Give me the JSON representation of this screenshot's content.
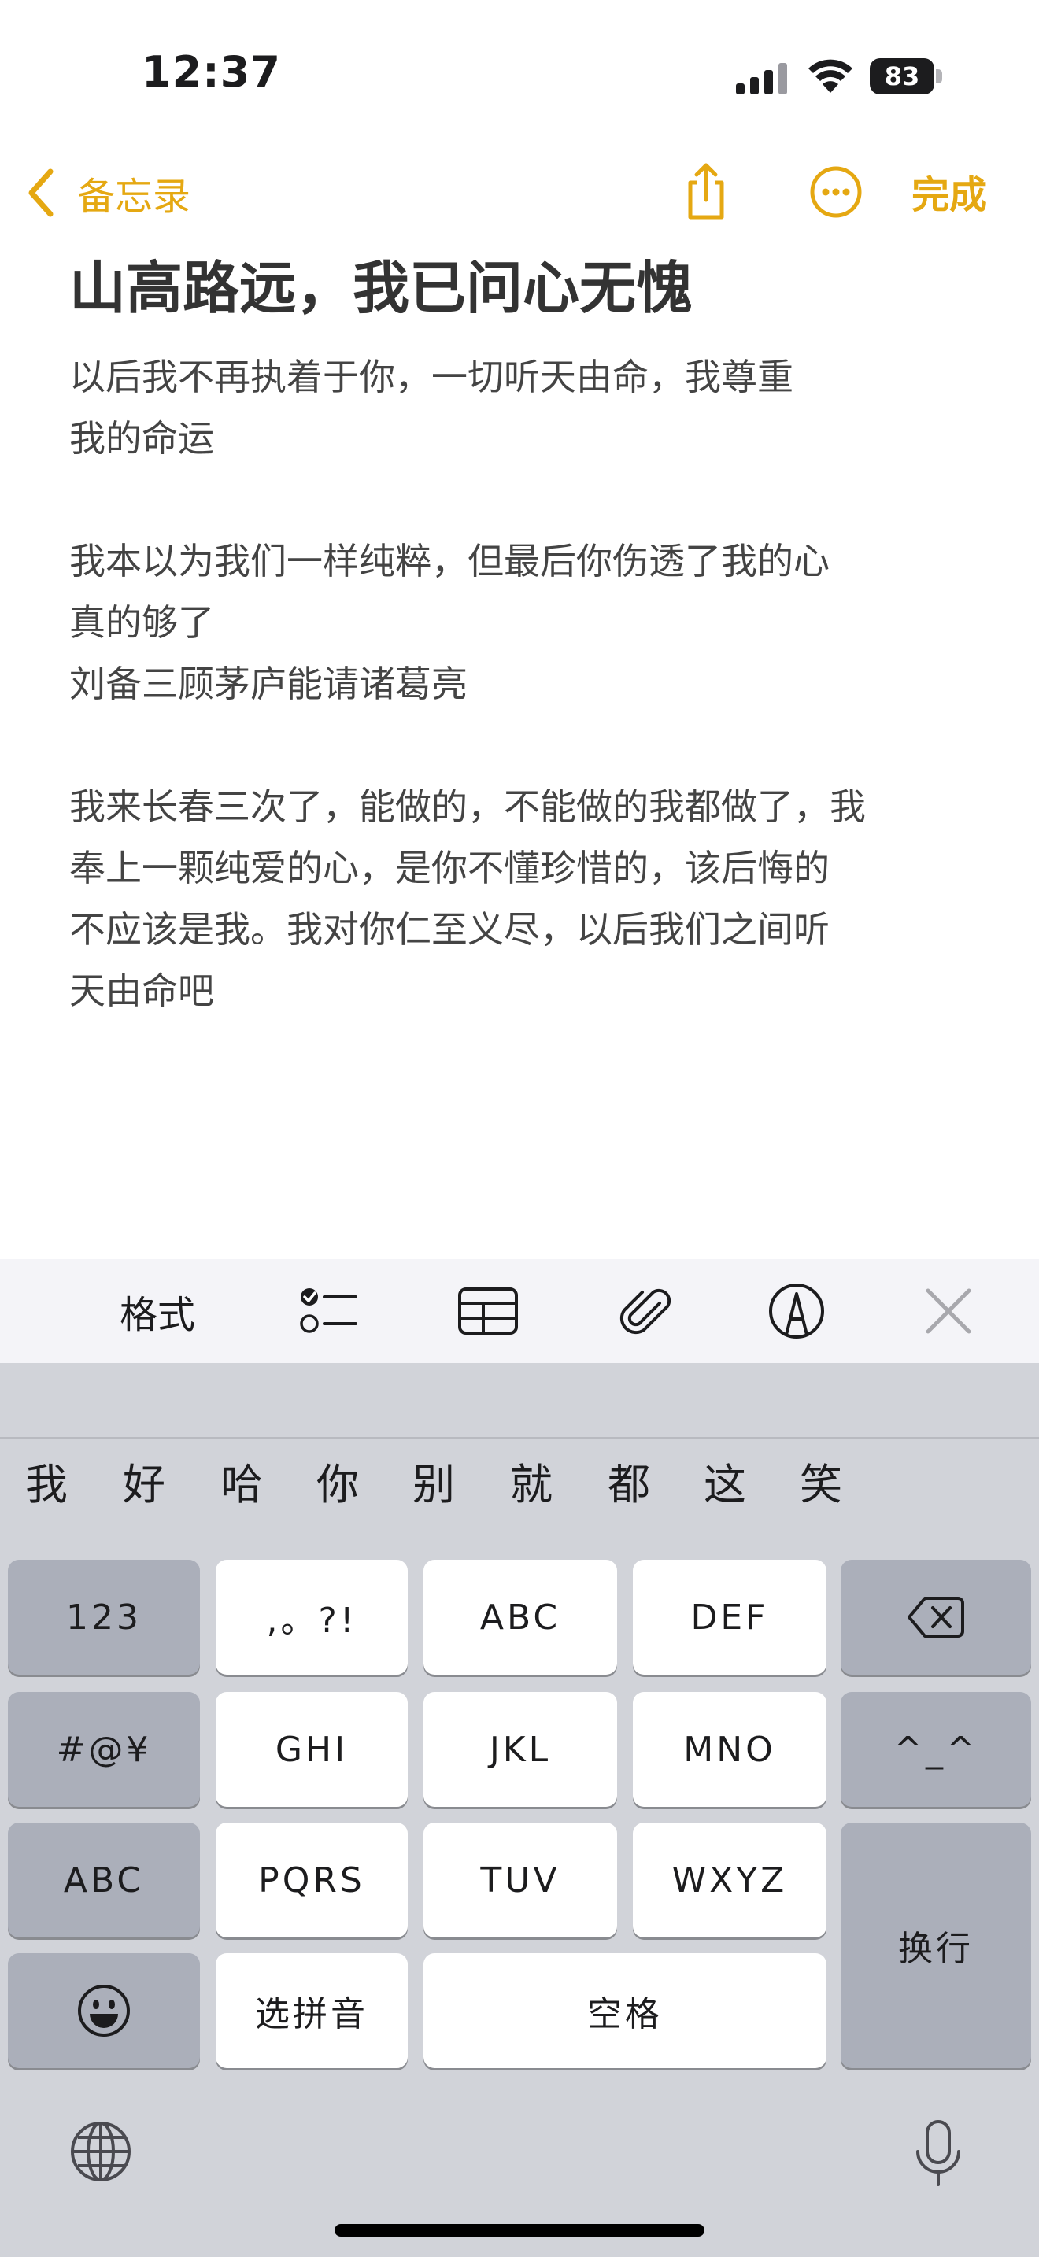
{
  "status_bar": {
    "time": "12:37",
    "battery": "83"
  },
  "nav": {
    "back_label": "备忘录",
    "done_label": "完成",
    "icons": [
      "chevron-left-icon",
      "share-icon",
      "more-icon"
    ]
  },
  "note": {
    "title": "山高路远，我已问心无愧",
    "body": "以后我不再执着于你，一切听天由命，我尊重\n我的命运\n\n我本以为我们一样纯粹，但最后你伤透了我的心\n真的够了\n刘备三顾茅庐能请诸葛亮\n\n我来长春三次了，能做的，不能做的我都做了，我\n奉上一颗纯爱的心，是你不懂珍惜的，该后悔的\n不应该是我。我对你仁至义尽，以后我们之间听\n天由命吧"
  },
  "toolbar": {
    "format_label": "格式",
    "icons": [
      "checklist-icon",
      "table-icon",
      "paperclip-icon",
      "markup-icon",
      "close-icon"
    ]
  },
  "keyboard": {
    "candidates": [
      "我",
      "好",
      "哈",
      "你",
      "别",
      "就",
      "都",
      "这",
      "笑"
    ],
    "keys": {
      "num": "123",
      "punct": ",。?!",
      "abc": "ABC",
      "def": "DEF",
      "sym": "#@¥",
      "ghi": "GHI",
      "jkl": "JKL",
      "mno": "MNO",
      "kaomoji": "^_^",
      "abc_mode": "ABC",
      "pqrs": "PQRS",
      "tuv": "TUV",
      "wxyz": "WXYZ",
      "return": "换行",
      "select_pinyin": "选拼音",
      "space": "空格"
    },
    "icons": [
      "delete-icon",
      "emoji-icon",
      "globe-icon",
      "microphone-icon"
    ]
  },
  "colors": {
    "accent": "#e5a812",
    "keyboard_bg": "#d1d3d9",
    "key_dark": "#abafba",
    "toolbar_bg": "#f4f4f8"
  }
}
